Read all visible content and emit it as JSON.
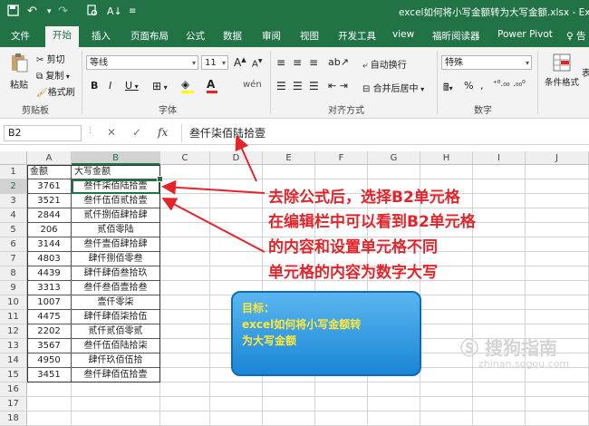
{
  "titlebar": {
    "doc_title": "excel如何将小写金额转为大写金额.xlsx  -  Excel"
  },
  "menu": [
    "文件",
    "开始",
    "插入",
    "页面布局",
    "公式",
    "数据",
    "审阅",
    "视图",
    "开发工具",
    "view",
    "福昕阅读器",
    "Power Pivot",
    "♀ 告"
  ],
  "ribbon": {
    "paste": "粘贴",
    "cut": "剪切",
    "copy": "复制",
    "format_painter": "格式刷",
    "clipboard": "剪贴板",
    "font_name": "等线",
    "font_size": "11",
    "grow": "A",
    "shrink": "A",
    "font_group": "字体",
    "wrap": "自动换行",
    "merge": "合并后居中",
    "align_group": "对齐方式",
    "number_format": "特殊",
    "number_group": "数字",
    "cond_format": "条件格式",
    "extra": "表"
  },
  "formula_bar": {
    "name_box": "B2",
    "fx": "fx",
    "content": "叁仟柒佰陆拾壹"
  },
  "columns": [
    "A",
    "B",
    "C",
    "D",
    "E",
    "F",
    "G",
    "H",
    "I",
    "J"
  ],
  "rows": [
    {
      "n": "1",
      "a": "金额",
      "b": "大写金额"
    },
    {
      "n": "2",
      "a": "3761",
      "b": "叁仟柒佰陆拾壹"
    },
    {
      "n": "3",
      "a": "3521",
      "b": "叁仟伍佰贰拾壹"
    },
    {
      "n": "4",
      "a": "2844",
      "b": "贰仟捌佰肆拾肆"
    },
    {
      "n": "5",
      "a": "206",
      "b": "贰佰零陆"
    },
    {
      "n": "6",
      "a": "3144",
      "b": "叁仟壹佰肆拾肆"
    },
    {
      "n": "7",
      "a": "4803",
      "b": "肆仟捌佰零叁"
    },
    {
      "n": "8",
      "a": "4439",
      "b": "肆仟肆佰叁拾玖"
    },
    {
      "n": "9",
      "a": "3313",
      "b": "叁仟叁佰壹拾叁"
    },
    {
      "n": "10",
      "a": "1007",
      "b": "壹仟零柒"
    },
    {
      "n": "11",
      "a": "4475",
      "b": "肆仟肆佰柒拾伍"
    },
    {
      "n": "12",
      "a": "2202",
      "b": "贰仟贰佰零贰"
    },
    {
      "n": "13",
      "a": "3567",
      "b": "叁仟伍佰陆拾柒"
    },
    {
      "n": "14",
      "a": "4950",
      "b": "肆仟玖佰伍拾"
    },
    {
      "n": "15",
      "a": "3451",
      "b": "叁仟肆佰伍拾壹"
    },
    {
      "n": "16",
      "a": "",
      "b": ""
    },
    {
      "n": "17",
      "a": "",
      "b": ""
    },
    {
      "n": "18",
      "a": "",
      "b": ""
    }
  ],
  "annotation": [
    "去除公式后，选择B2单元格",
    "在编辑栏中可以看到B2单元格",
    "的内容和设置单元格不同",
    "单元格的内容为数字大写"
  ],
  "goal": {
    "title": "目标：",
    "line1": "excel如何将小写金额转",
    "line2": "为大写金额"
  },
  "watermark": {
    "logo": "搜狗指南",
    "url": "zhinan.sogou.com"
  },
  "colors": {
    "excel_green": "#217346",
    "annotation_red": "#e3242b",
    "goal_blue": "#1a86d6"
  }
}
